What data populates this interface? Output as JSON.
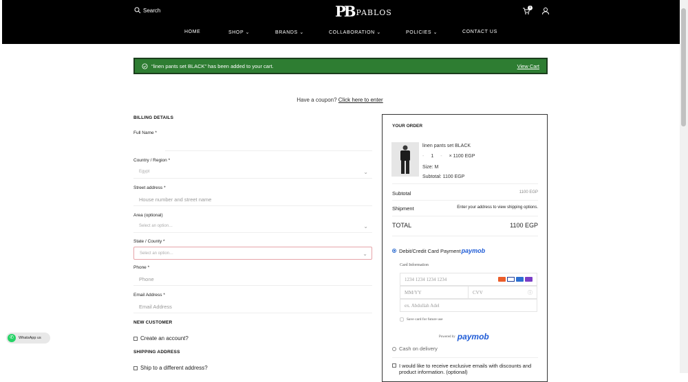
{
  "header": {
    "search_label": "Search",
    "logo_monogram": "PB",
    "logo_word": "PABLOS",
    "cart_count": "1",
    "nav": [
      {
        "label": "HOME"
      },
      {
        "label": "SHOP ⌄"
      },
      {
        "label": "BRANDS ⌄"
      },
      {
        "label": "COLLABORATION ⌄"
      },
      {
        "label": "POLICIES ⌄"
      },
      {
        "label": "CONTACT US"
      }
    ]
  },
  "notice": {
    "message": "“linen pants set BLACK” has been added to your cart.",
    "link": "View Cart",
    "color": "#2e7d32"
  },
  "coupon": {
    "text": "Have a coupon?",
    "link": "Click here to enter"
  },
  "billing": {
    "title": "BILLING DETAILS",
    "full_name_label": "Full Name *",
    "country_label": "Country / Region *",
    "country_value": "Egypt",
    "street_label": "Street address *",
    "street_placeholder": "House number and street name",
    "area_label": "Area (optional)",
    "area_value": "Select an option…",
    "state_label": "State / County *",
    "state_value": "Select an option…",
    "phone_label": "Phone *",
    "phone_placeholder": "Phone",
    "email_label": "Email Address *",
    "email_placeholder": "Email Address"
  },
  "new_customer": {
    "title": "NEW CUSTOMER",
    "create_account": "Create an account?"
  },
  "shipping": {
    "title": "SHIPPING ADDRESS",
    "different": "Ship to a different address?"
  },
  "order": {
    "title": "YOUR ORDER",
    "product_name": "linen pants set BLACK",
    "qty": "1",
    "price": "× 1100 EGP",
    "size": "Size: M",
    "subtotal_line": "Subtotal: 1100 EGP",
    "subtotal_label": "Subtotal",
    "subtotal_value": "1100 EGP",
    "shipment_label": "Shipment",
    "shipment_value": "Enter your address to view shipping options.",
    "total_label": "TOTAL",
    "total_value": "1100 EGP",
    "payment_card_label": "Debit/Credit Card Payment",
    "paymob": "paymob",
    "card_info_label": "Card Information",
    "card_number_placeholder": "1234 1234 1234 1234",
    "expiry_placeholder": "MM/YY",
    "cvv_placeholder": "CVV",
    "name_placeholder": "ex. Abdullah Adel",
    "save_card": "Save card for future use",
    "powered_by": "Powered by",
    "cod_label": "Cash on delivery",
    "newsletter": "I would like to receive exclusive emails with discounts and product information. (optional)"
  },
  "whatsapp": {
    "label": "WhatsApp us",
    "color": "#25d366"
  }
}
